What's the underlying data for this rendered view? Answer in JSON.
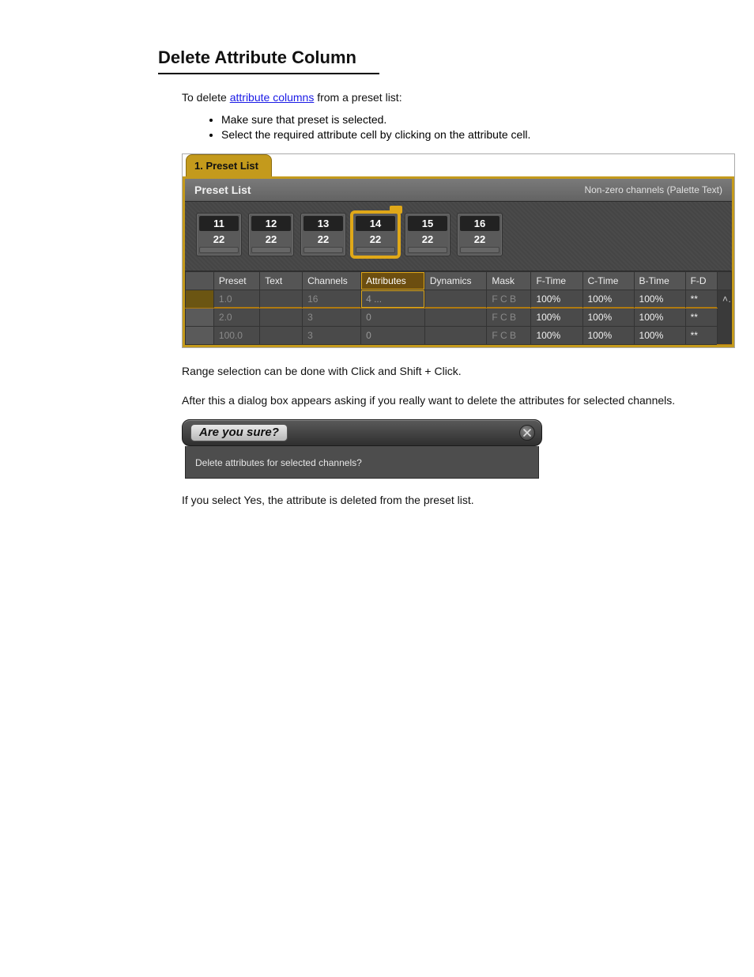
{
  "section": {
    "title": "Delete Attribute Column"
  },
  "text": {
    "p1_prefix": "To delete ",
    "p1_link": "attribute columns",
    "p1_suffix": " from a preset list:",
    "b1": "Make sure that preset is selected.",
    "b2": "Select the required attribute cell by clicking on the attribute cell.",
    "p2": "Range selection can be done with Click and Shift + Click.",
    "p3": "After this a dialog box appears asking if you really want to delete the attributes for selected channels.",
    "p4": "If you select Yes, the attribute is deleted from the preset list."
  },
  "preset_panel": {
    "tab_label": "1. Preset List",
    "title_left": "Preset List",
    "title_right": "Non-zero channels (Palette Text)",
    "chips": [
      {
        "top": "11",
        "bot": "22",
        "selected": false
      },
      {
        "top": "12",
        "bot": "22",
        "selected": false
      },
      {
        "top": "13",
        "bot": "22",
        "selected": false
      },
      {
        "top": "14",
        "bot": "22",
        "selected": true
      },
      {
        "top": "15",
        "bot": "22",
        "selected": false
      },
      {
        "top": "16",
        "bot": "22",
        "selected": false
      }
    ],
    "columns": [
      "Preset",
      "Text",
      "Channels",
      "Attributes",
      "Dynamics",
      "Mask",
      "F-Time",
      "C-Time",
      "B-Time",
      "F-D"
    ],
    "rows": [
      {
        "preset": "1.0",
        "text": "",
        "channels": "16",
        "attributes": "4     ...",
        "dynamics": "",
        "mask": "F C B",
        "ftime": "100%",
        "ctime": "100%",
        "btime": "100%",
        "fd": "**",
        "selected": true,
        "attr_focus": true
      },
      {
        "preset": "2.0",
        "text": "",
        "channels": "3",
        "attributes": "0",
        "dynamics": "",
        "mask": "F C B",
        "ftime": "100%",
        "ctime": "100%",
        "btime": "100%",
        "fd": "**",
        "selected": false,
        "attr_focus": false
      },
      {
        "preset": "100.0",
        "text": "",
        "channels": "3",
        "attributes": "0",
        "dynamics": "",
        "mask": "F C B",
        "ftime": "100%",
        "ctime": "100%",
        "btime": "100%",
        "fd": "**",
        "selected": false,
        "attr_focus": false
      }
    ]
  },
  "dialog": {
    "title": "Are you sure?",
    "body": "Delete attributes for selected channels?"
  }
}
